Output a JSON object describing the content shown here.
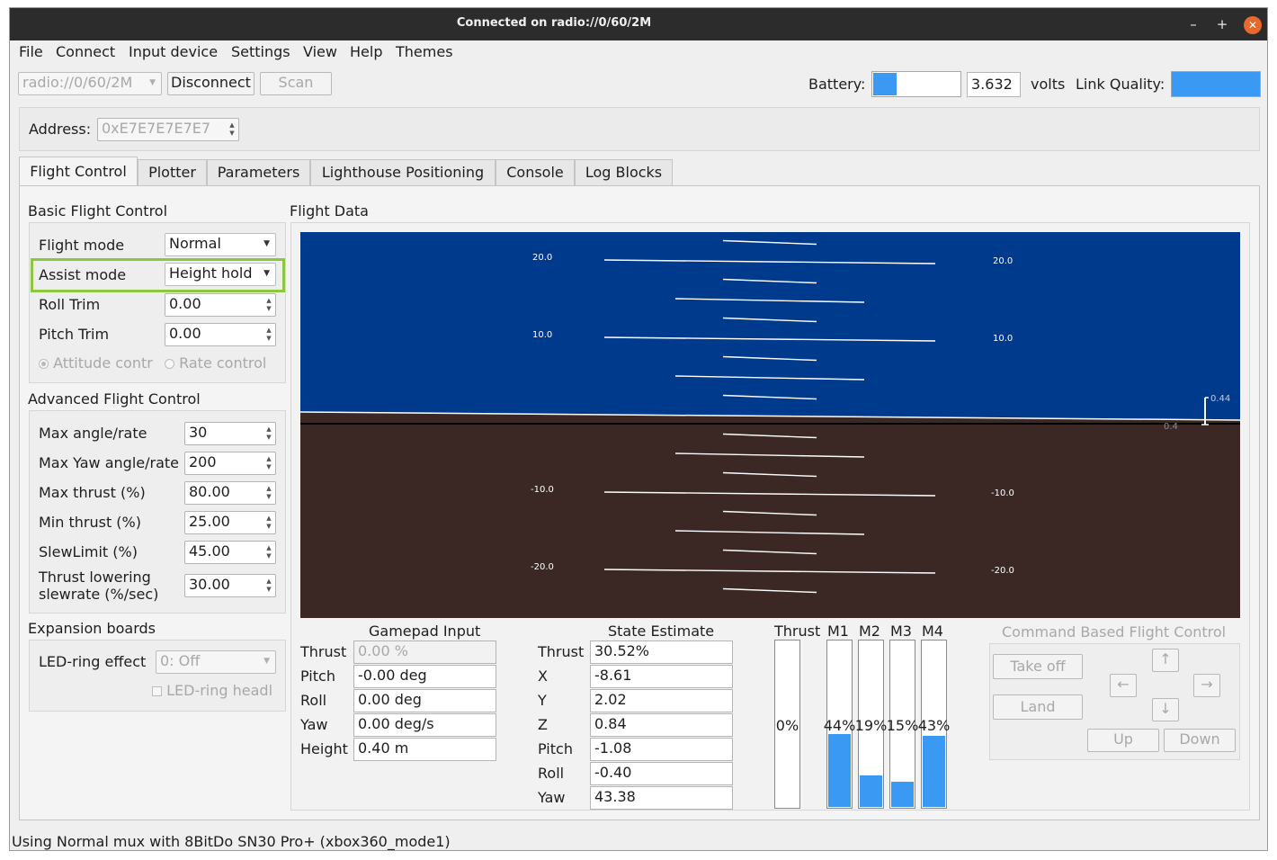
{
  "window": {
    "title": "Connected on radio://0/60/2M",
    "min_glyph": "–",
    "max_glyph": "+",
    "close_glyph": "✕"
  },
  "menu": [
    "File",
    "Connect",
    "Input device",
    "Settings",
    "View",
    "Help",
    "Themes"
  ],
  "toolbar": {
    "uri": "radio://0/60/2M",
    "disconnect": "Disconnect",
    "scan": "Scan",
    "battery_label": "Battery:",
    "battery_fraction": 0.27,
    "battery_value": "3.632",
    "volts": "volts",
    "link_label": "Link Quality:",
    "link_fraction": 1.0
  },
  "address": {
    "label": "Address:",
    "value": "0xE7E7E7E7E7"
  },
  "tabs": [
    "Flight Control",
    "Plotter",
    "Parameters",
    "Lighthouse Positioning",
    "Console",
    "Log Blocks"
  ],
  "basic": {
    "title": "Basic Flight Control",
    "flight_mode_label": "Flight mode",
    "flight_mode": "Normal",
    "assist_mode_label": "Assist mode",
    "assist_mode": "Height hold",
    "roll_trim_label": "Roll Trim",
    "roll_trim": "0.00",
    "pitch_trim_label": "Pitch Trim",
    "pitch_trim": "0.00",
    "attitude": "Attitude contr",
    "rate": "Rate control"
  },
  "advanced": {
    "title": "Advanced Flight Control",
    "rows": [
      {
        "label": "Max angle/rate",
        "value": "30"
      },
      {
        "label": "Max Yaw angle/rate",
        "value": "200"
      },
      {
        "label": "Max thrust (%)",
        "value": "80.00"
      },
      {
        "label": "Min thrust (%)",
        "value": "25.00"
      },
      {
        "label": "SlewLimit (%)",
        "value": "45.00"
      }
    ],
    "thrust_lower_label1": "Thrust lowering",
    "thrust_lower_label2": "slewrate (%/sec)",
    "thrust_lower": "30.00"
  },
  "expansion": {
    "title": "Expansion boards",
    "led_label": "LED-ring effect",
    "led_value": "0: Off",
    "headlight": "LED-ring headl"
  },
  "flight_data": {
    "title": "Flight Data",
    "horizon": {
      "pitch_labels": [
        "20.0",
        "10.0",
        "-10.0",
        "-20.0"
      ],
      "alt_target": "0.44",
      "alt_actual": "0.4",
      "sky": "#003a8c",
      "ground": "#3b2824"
    }
  },
  "gamepad": {
    "title": "Gamepad Input",
    "rows": [
      {
        "label": "Thrust",
        "value": "0.00 %"
      },
      {
        "label": "Pitch",
        "value": "-0.00 deg"
      },
      {
        "label": "Roll",
        "value": "0.00 deg"
      },
      {
        "label": "Yaw",
        "value": "0.00 deg/s"
      },
      {
        "label": "Height",
        "value": "0.40 m"
      }
    ]
  },
  "state": {
    "title": "State Estimate",
    "rows": [
      {
        "label": "Thrust",
        "value": "30.52%"
      },
      {
        "label": "X",
        "value": "-8.61"
      },
      {
        "label": "Y",
        "value": "2.02"
      },
      {
        "label": "Z",
        "value": "0.84"
      },
      {
        "label": "Pitch",
        "value": "-1.08"
      },
      {
        "label": "Roll",
        "value": "-0.40"
      },
      {
        "label": "Yaw",
        "value": "43.38"
      }
    ]
  },
  "motors": {
    "bars": [
      {
        "label": "Thrust",
        "text": "0%",
        "fraction": 0.0
      },
      {
        "label": "M1",
        "text": "44%",
        "fraction": 0.44
      },
      {
        "label": "M2",
        "text": "19%",
        "fraction": 0.19
      },
      {
        "label": "M3",
        "text": "15%",
        "fraction": 0.15
      },
      {
        "label": "M4",
        "text": "43%",
        "fraction": 0.43
      }
    ]
  },
  "command": {
    "title": "Command Based Flight Control",
    "takeoff": "Take off",
    "land": "Land",
    "up": "Up",
    "down": "Down",
    "arrow_up": "↑",
    "arrow_down": "↓",
    "arrow_left": "←",
    "arrow_right": "→"
  },
  "status_bar": "Using Normal mux with 8BitDo SN30 Pro+ (xbox360_mode1)",
  "colors": {
    "highlight": "#8dc63f",
    "bar_fill": "#3a9af3",
    "titlebar": "#2c2c2c",
    "close": "#e9692c"
  }
}
